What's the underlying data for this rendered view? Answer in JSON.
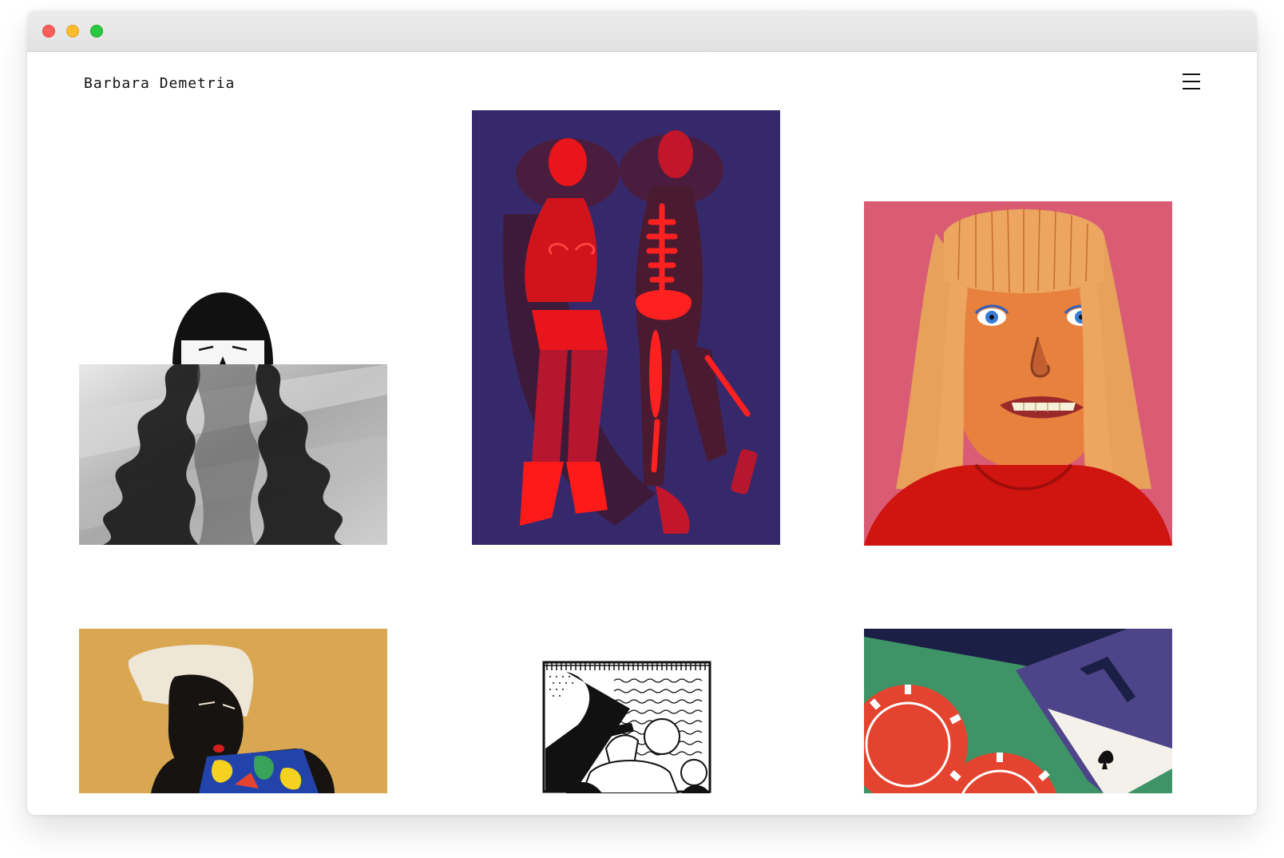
{
  "header": {
    "site_title": "Barbara Demetria",
    "menu_icon": "hamburger-menu-icon"
  },
  "window": {
    "controls": [
      "close",
      "minimize",
      "zoom"
    ]
  },
  "gallery": {
    "items": [
      {
        "subject": "woman with long black hair behind textured gray panel",
        "palette": [
          "#111111",
          "#9a9a9a",
          "#d8d8d8"
        ]
      },
      {
        "subject": "two women lying down, one with red skeleton overlay",
        "palette": [
          "#36296b",
          "#e8151a",
          "#b7172e"
        ]
      },
      {
        "subject": "portrait of blonde woman with bared teeth on pink",
        "palette": [
          "#d95c74",
          "#e8813e",
          "#d0140f"
        ]
      },
      {
        "subject": "black woman with white hair and colorful top on mustard",
        "palette": [
          "#d9a752",
          "#171310",
          "#eee6d6"
        ]
      },
      {
        "subject": "black and white comic panel of figures under a blanket",
        "palette": [
          "#111111",
          "#ffffff"
        ]
      },
      {
        "subject": "poker chips and ace of spades on green table",
        "palette": [
          "#3f9467",
          "#e4432f",
          "#4e4489"
        ]
      }
    ]
  }
}
